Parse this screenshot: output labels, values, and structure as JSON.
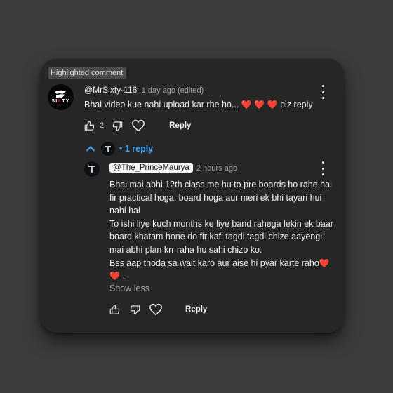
{
  "highlighted_label": "Highlighted comment",
  "comment": {
    "username": "@MrSixty-116",
    "time": "1 day ago (edited)",
    "text_before": "Bhai video kue nahi upload kar rhe ho...",
    "text_after": "plz reply",
    "hearts": [
      "❤️",
      "❤️",
      "❤️"
    ],
    "avatar_text": "SIXTY",
    "like_count": "2",
    "reply_label": "Reply"
  },
  "replies_toggle": {
    "label": "• 1 reply"
  },
  "reply": {
    "handle": "@The_PrinceMaurya",
    "time": "2 hours ago",
    "lines": [
      "Bhai mai abhi 12th class me hu to pre boards ho rahe hai",
      "fir practical hoga, board hoga aur meri ek bhi tayari hui",
      "nahi hai",
      "To ishi liye kuch months ke liye band rahega lekin ek baar",
      "board khatam hone do fir kafi tagdi tagdi chize aayengi",
      "mai abhi plan krr raha hu sahi chizo ko.",
      "Bss aap thoda sa wait karo aur aise hi pyar karte raho"
    ],
    "ending_hearts": [
      "❤️",
      "❤️"
    ],
    "ending_period": ".",
    "show_less": "Show less",
    "reply_label": "Reply"
  },
  "colors": {
    "background": "#3c3c3c",
    "card": "#262626",
    "link_blue": "#3ea6ff",
    "heart_red": "#e0245e",
    "text": "#f1f1f1",
    "secondary_text": "#aaaaaa"
  },
  "icons": [
    "kebab-menu-icon",
    "thumbs-up-icon",
    "thumbs-down-icon",
    "heart-icon",
    "chevron-up-icon"
  ]
}
